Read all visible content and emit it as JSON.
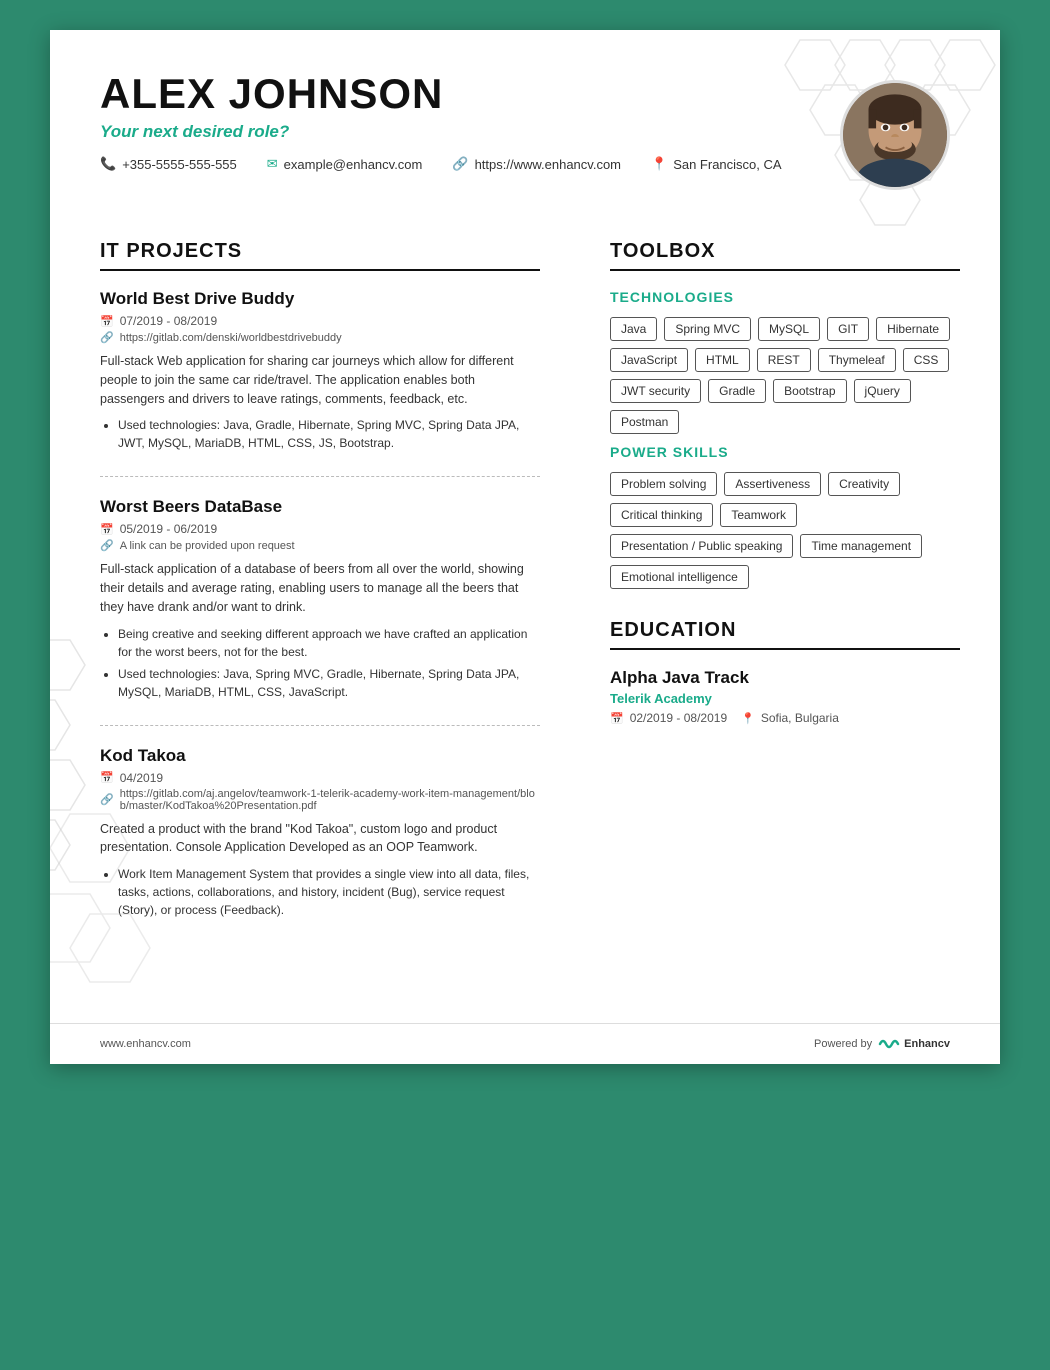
{
  "header": {
    "name": "ALEX JOHNSON",
    "role": "Your next desired role?",
    "phone": "+355-5555-555-555",
    "website": "https://www.enhancv.com",
    "email": "example@enhancv.com",
    "location": "San Francisco, CA"
  },
  "left": {
    "section_title": "IT PROJECTS",
    "projects": [
      {
        "title": "World Best Drive Buddy",
        "dates": "07/2019 - 08/2019",
        "link": "https://gitlab.com/denski/worldbestdrivebuddy",
        "desc": "Full-stack Web application for sharing car journeys which allow for different people to join the same car ride/travel. The application enables both passengers and drivers to leave ratings, comments, feedback, etc.",
        "bullets": [
          "Used technologies: Java, Gradle, Hibernate, Spring MVC, Spring Data JPA, JWT, MySQL, MariaDB, HTML, CSS, JS, Bootstrap."
        ]
      },
      {
        "title": "Worst Beers DataBase",
        "dates": "05/2019 - 06/2019",
        "link": "A link can be provided upon request",
        "desc": "Full-stack application of a database of beers from all over the world, showing their details and average rating, enabling users to manage all the beers that they have drank and/or want to drink.",
        "bullets": [
          "Being creative and seeking different approach we have crafted an application for the worst beers, not for the best.",
          "Used technologies: Java, Spring MVC, Gradle, Hibernate, Spring Data JPA, MySQL, MariaDB, HTML, CSS, JavaScript."
        ]
      },
      {
        "title": "Kod Takoa",
        "dates": "04/2019",
        "link": "https://gitlab.com/aj.angelov/teamwork-1-telerik-academy-work-item-management/blob/master/KodTakoa%20Presentation.pdf",
        "desc": "Created a product with the brand \"Kod Takoa\", custom logo and product presentation. Console Application Developed as an OOP Teamwork.",
        "bullets": [
          "Work Item Management System that provides a single view into all data, files, tasks, actions, collaborations, and history, incident (Bug), service request (Story), or process (Feedback)."
        ]
      }
    ]
  },
  "right": {
    "toolbox_title": "TOOLBOX",
    "technologies_label": "TECHNOLOGIES",
    "technologies": [
      "Java",
      "Spring MVC",
      "MySQL",
      "GIT",
      "Hibernate",
      "JavaScript",
      "HTML",
      "REST",
      "Thymeleaf",
      "CSS",
      "JWT security",
      "Gradle",
      "Bootstrap",
      "jQuery",
      "Postman"
    ],
    "power_skills_label": "POWER SKILLS",
    "power_skills": [
      "Problem solving",
      "Assertiveness",
      "Creativity",
      "Critical thinking",
      "Teamwork",
      "Presentation / Public speaking",
      "Time management",
      "Emotional intelligence"
    ],
    "education_title": "EDUCATION",
    "edu_degree": "Alpha Java Track",
    "edu_school": "Telerik Academy",
    "edu_dates": "02/2019 - 08/2019",
    "edu_location": "Sofia, Bulgaria"
  },
  "footer": {
    "url": "www.enhancv.com",
    "powered_by": "Powered by",
    "brand": "Enhancv"
  }
}
